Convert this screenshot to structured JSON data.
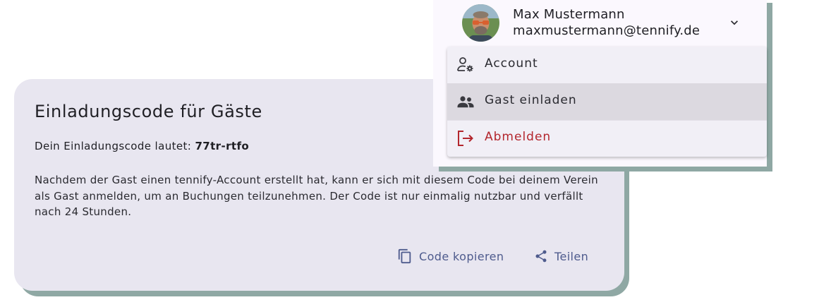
{
  "invite_card": {
    "title": "Einladungscode für Gäste",
    "code_prefix": "Dein Einladungscode lautet: ",
    "code": "77tr-rtfo",
    "description": "Nachdem der Gast einen tennify-Account erstellt hat, kann er sich mit diesem Code bei deinem Verein als Gast anmelden, um an Buchungen teilzunehmen. Der Code ist nur einmalig nutzbar und verfällt nach 24 Stunden.",
    "copy_label": "Code kopieren",
    "share_label": "Teilen"
  },
  "user": {
    "name": "Max Mustermann",
    "email": "maxmustermann@tennify.de"
  },
  "menu": {
    "items": [
      {
        "label": "Account",
        "icon": "user-gear-icon"
      },
      {
        "label": "Gast einladen",
        "icon": "people-icon"
      },
      {
        "label": "Abmelden",
        "icon": "logout-icon"
      }
    ]
  },
  "colors": {
    "card_background": "#e8e6f0",
    "accent": "#4e5b8d",
    "shadow": "#8fa8a4",
    "logout": "#b3262d",
    "selected_item": "#dcd9e0"
  }
}
